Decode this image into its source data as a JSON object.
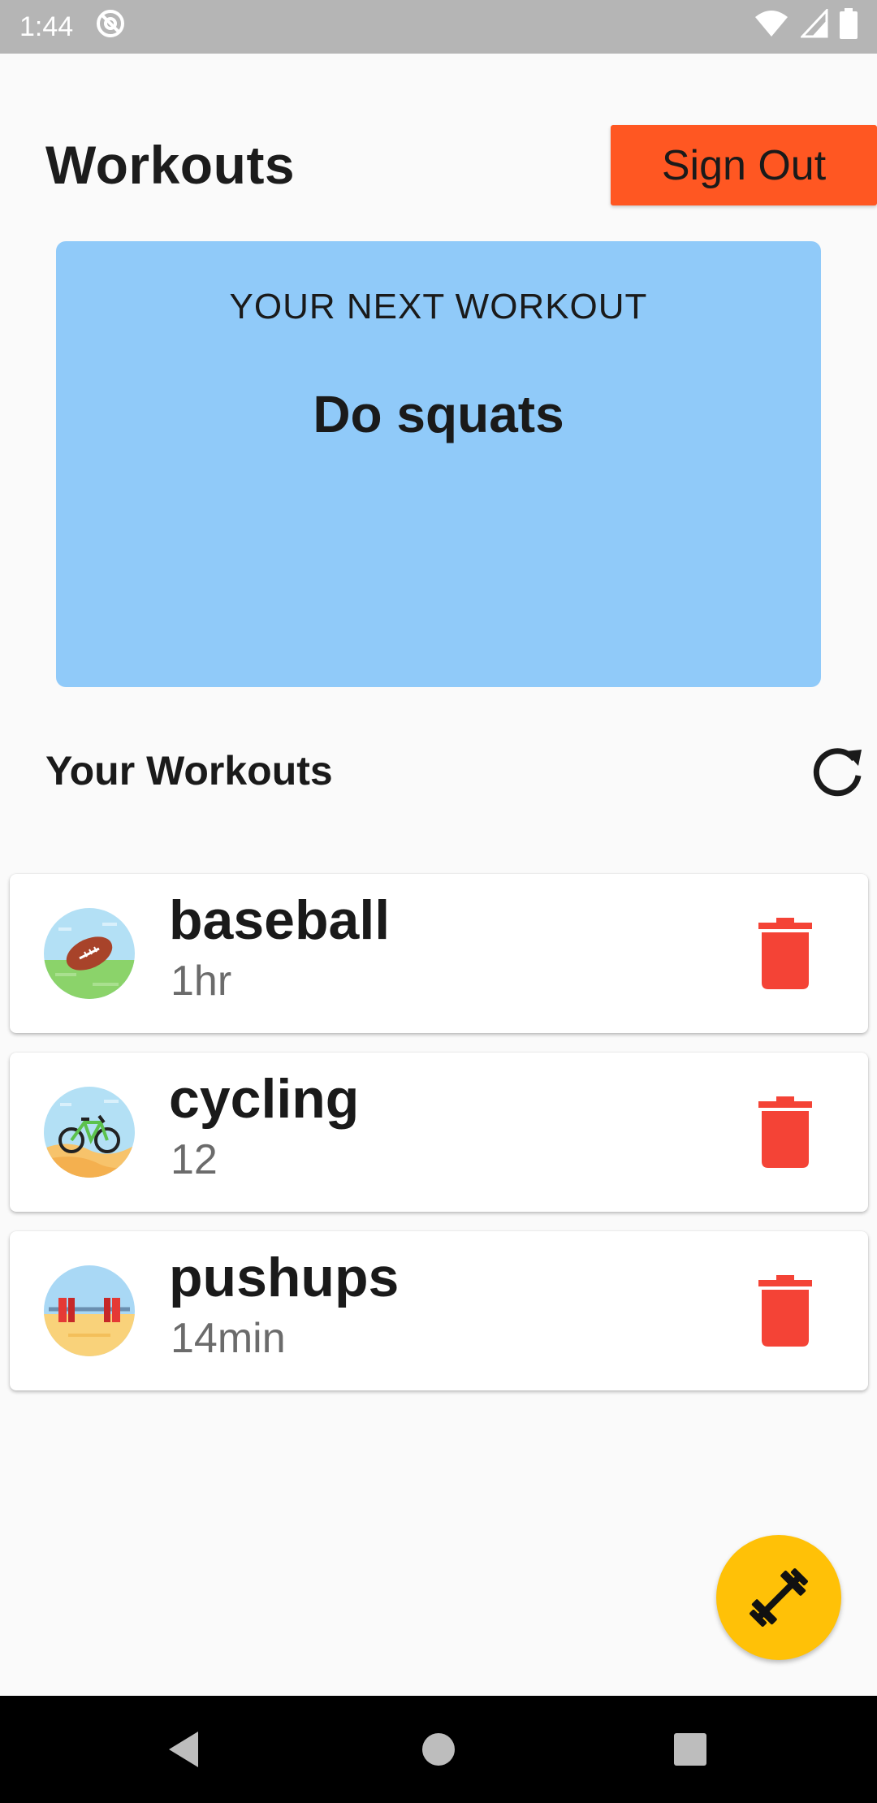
{
  "status_bar": {
    "time": "1:44"
  },
  "header": {
    "title": "Workouts",
    "sign_out_label": "Sign Out"
  },
  "next_workout": {
    "label": "YOUR NEXT WORKOUT",
    "title": "Do squats"
  },
  "workouts_section": {
    "title": "Your Workouts"
  },
  "workouts": [
    {
      "name": "baseball",
      "duration": "1hr",
      "icon": "football-field-icon"
    },
    {
      "name": "cycling",
      "duration": "12",
      "icon": "bicycle-icon"
    },
    {
      "name": "pushups",
      "duration": "14min",
      "icon": "barbell-beach-icon"
    }
  ],
  "colors": {
    "sign_out_bg": "#ff5722",
    "card_bg": "#90caf9",
    "delete_red": "#f44336",
    "fab_bg": "#ffc107"
  }
}
